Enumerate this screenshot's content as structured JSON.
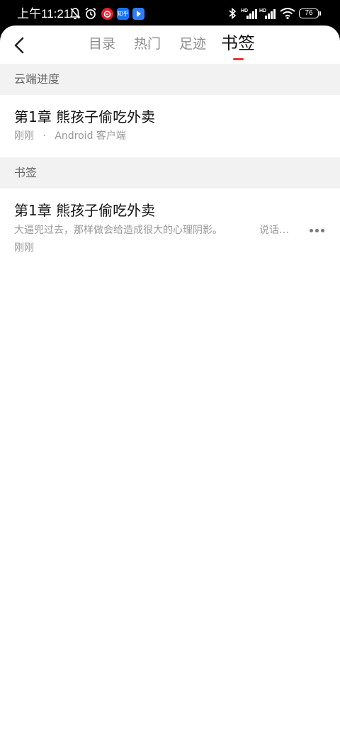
{
  "status_bar": {
    "time": "上午11:21",
    "apps": [
      "知乎"
    ],
    "battery": "76"
  },
  "nav": {
    "tabs": [
      "目录",
      "热门",
      "足迹",
      "书签"
    ],
    "active_tab": "书签"
  },
  "cloud_section": {
    "title": "云端进度",
    "item": {
      "title": "第1章 熊孩子偷吃外卖",
      "time": "刚刚",
      "separator": "·",
      "device": "Android 客户端"
    }
  },
  "bookmark_section": {
    "title": "书签",
    "items": [
      {
        "title": "第1章 熊孩子偷吃外卖",
        "excerpt": "大逼兜过去，那样做会给造成很大的心理阴影。",
        "comment": "说话…",
        "time": "刚刚"
      }
    ]
  }
}
